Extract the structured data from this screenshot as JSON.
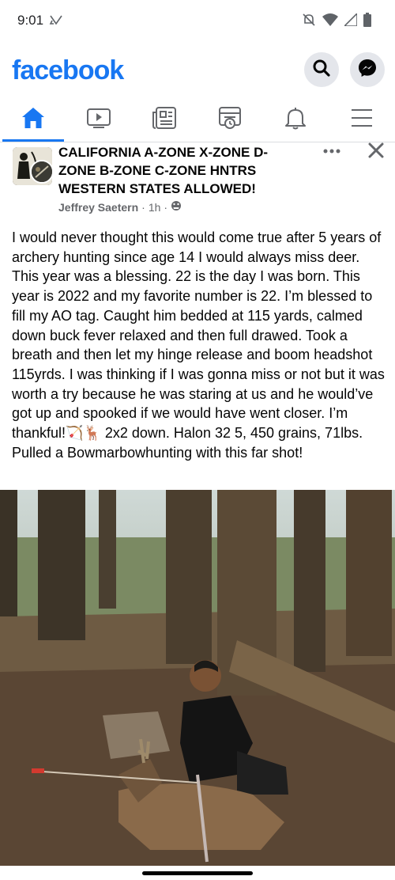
{
  "status_bar": {
    "time": "9:01"
  },
  "header": {
    "logo": "facebook",
    "search_icon": "search-icon",
    "messenger_icon": "messenger-icon"
  },
  "tabs": [
    {
      "name": "home",
      "icon": "home-icon",
      "active": true
    },
    {
      "name": "watch",
      "icon": "video-icon",
      "active": false
    },
    {
      "name": "news",
      "icon": "news-feed-icon",
      "active": false
    },
    {
      "name": "marketplace",
      "icon": "marketplace-icon",
      "active": false
    },
    {
      "name": "notifications",
      "icon": "bell-icon",
      "active": false
    },
    {
      "name": "menu",
      "icon": "hamburger-icon",
      "active": false
    }
  ],
  "post": {
    "group_name": "CALIFORNIA A-ZONE X-ZONE D-ZONE B-ZONE C-ZONE HNTRS WESTERN STATES ALLOWED!",
    "author": "Jeffrey Saetern",
    "separator": "·",
    "time": "1h",
    "separator2": "·",
    "body": "I would never thought this would come true after 5 years of archery hunting since age 14 I would always miss deer. This year was a blessing. 22 is the day I was born. This year is 2022 and my favorite number is 22. I’m blessed to fill my AO tag. Caught him bedded at 115 yards, calmed down buck fever relaxed and then full drawed. Took a breath and then let my hinge release and boom headshot 115yrds. I was thinking if I was gonna miss or not but it was worth a try because he was staring at us and he would’ve got up and spooked if we would have went closer. I’m thankful!🏹🦌 2x2 down. Halon 32 5, 450 grains, 71lbs. Pulled a Bowmarbowhunting with this far shot!"
  },
  "colors": {
    "brand": "#1877f2",
    "secondary_text": "#65676b",
    "button_bg": "#e4e6eb"
  }
}
